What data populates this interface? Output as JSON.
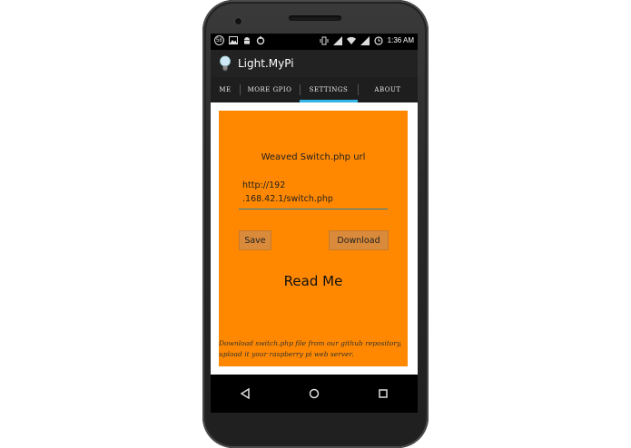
{
  "status_bar": {
    "notification_count": "58",
    "time": "1:36 AM"
  },
  "action_bar": {
    "title": "Light.MyPi"
  },
  "tabs": [
    {
      "label": "ME",
      "active": false
    },
    {
      "label": "MORE GPIO",
      "active": false
    },
    {
      "label": "SETTINGS",
      "active": true
    },
    {
      "label": "ABOUT",
      "active": false
    }
  ],
  "settings": {
    "url_label": "Weaved Switch.php url",
    "url_value_line1": "http://192",
    "url_value_line2": ".168.42.1/switch.php",
    "save_label": "Save",
    "download_label": "Download",
    "readme_title": "Read Me",
    "readme_note": "Download switch.php file from our github repository, upload it your raspberry pi web server."
  },
  "colors": {
    "panel": "#ff8800",
    "tab_indicator": "#33b5e5",
    "action_bar": "#222222"
  },
  "icons": {
    "status_left": [
      "notification-badge-icon",
      "image-icon",
      "android-icon",
      "sync-icon"
    ],
    "status_right": [
      "vibrate-icon",
      "signal-bars-icon",
      "wifi-icon",
      "network-icon",
      "alarm-clock-icon"
    ],
    "navigation": [
      "back-icon",
      "home-icon",
      "recents-icon"
    ]
  }
}
